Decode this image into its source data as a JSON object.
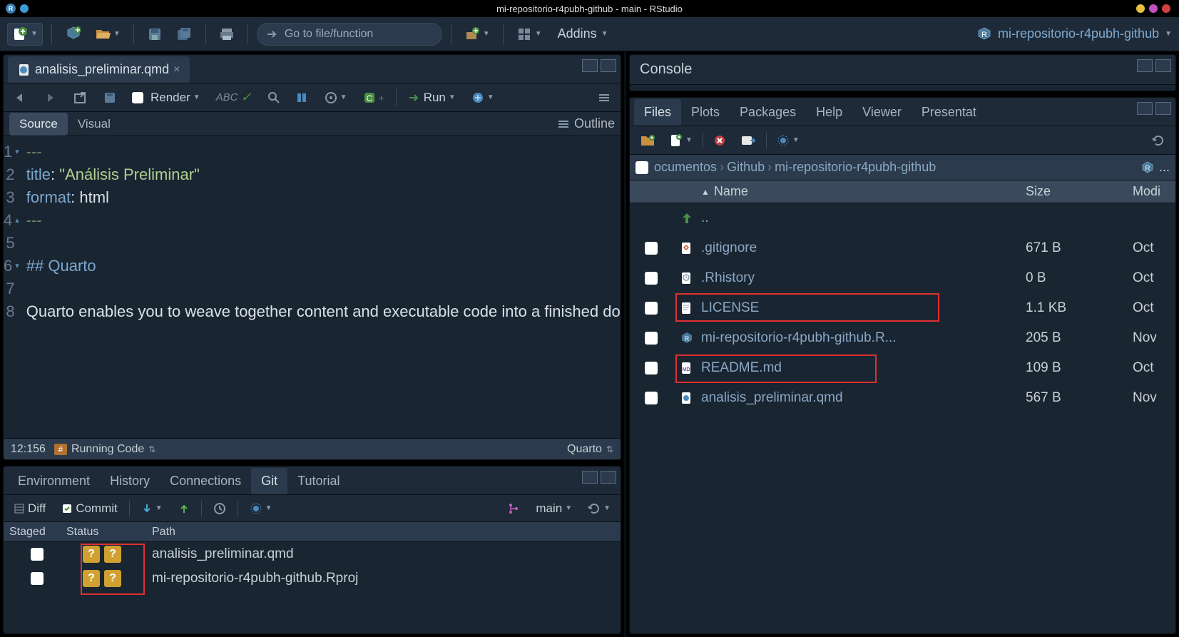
{
  "titlebar": {
    "title": "mi-repositorio-r4pubh-github - main - RStudio"
  },
  "main_toolbar": {
    "goto_placeholder": "Go to file/function",
    "addins_label": "Addins",
    "project_name": "mi-repositorio-r4pubh-github"
  },
  "source_pane": {
    "tab_label": "analisis_preliminar.qmd",
    "render_label": "Render",
    "run_label": "Run",
    "source_tab": "Source",
    "visual_tab": "Visual",
    "outline_label": "Outline",
    "code": {
      "l1": "---",
      "l2a": "title",
      "l2b": ": ",
      "l2c": "\"Análisis Preliminar\"",
      "l3a": "format",
      "l3b": ": html",
      "l4": "---",
      "l6": "## Quarto",
      "l8": "Quarto enables you to weave together content and executable code into a finished document. To learn more about"
    },
    "status": {
      "cursor": "12:156",
      "section": "Running Code",
      "filetype": "Quarto"
    }
  },
  "env_pane": {
    "tabs": [
      "Environment",
      "History",
      "Connections",
      "Git",
      "Tutorial"
    ],
    "active_tab": "Git",
    "git": {
      "diff_label": "Diff",
      "commit_label": "Commit",
      "branch": "main",
      "headers": {
        "staged": "Staged",
        "status": "Status",
        "path": "Path"
      },
      "rows": [
        {
          "path": "analisis_preliminar.qmd"
        },
        {
          "path": "mi-repositorio-r4pubh-github.Rproj"
        }
      ]
    }
  },
  "console_pane": {
    "title": "Console"
  },
  "files_pane": {
    "tabs": [
      "Files",
      "Plots",
      "Packages",
      "Help",
      "Viewer",
      "Presentat"
    ],
    "active_tab": "Files",
    "breadcrumb": [
      "ocumentos",
      "Github",
      "mi-repositorio-r4pubh-github"
    ],
    "headers": {
      "name": "Name",
      "size": "Size",
      "modified": "Modi"
    },
    "updir": "..",
    "rows": [
      {
        "name": ".gitignore",
        "size": "671 B",
        "mod": "Oct"
      },
      {
        "name": ".Rhistory",
        "size": "0 B",
        "mod": "Oct"
      },
      {
        "name": "LICENSE",
        "size": "1.1 KB",
        "mod": "Oct"
      },
      {
        "name": "mi-repositorio-r4pubh-github.R...",
        "size": "205 B",
        "mod": "Nov"
      },
      {
        "name": "README.md",
        "size": "109 B",
        "mod": "Oct"
      },
      {
        "name": "analisis_preliminar.qmd",
        "size": "567 B",
        "mod": "Nov"
      }
    ]
  }
}
